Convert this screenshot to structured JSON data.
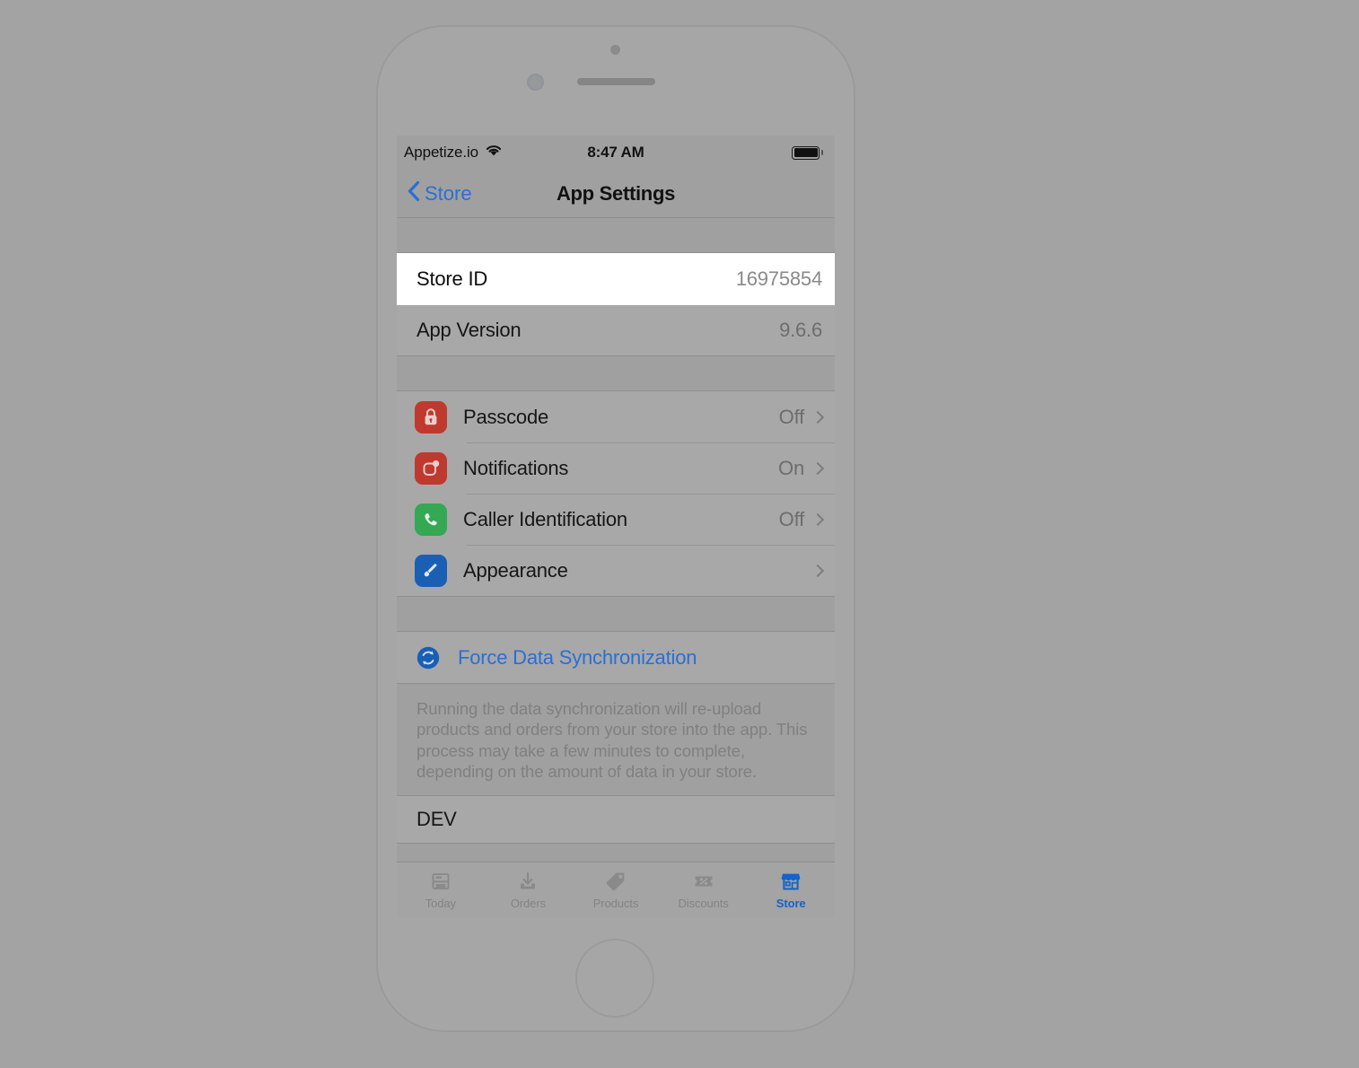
{
  "background_color": "#a3a3a3",
  "device": {
    "name": "iphone-frame",
    "frame_color": "#9a9a9a",
    "parts": [
      "sensor-dot",
      "front-camera",
      "earpiece-speaker",
      "home-button"
    ]
  },
  "status_bar": {
    "carrier": "Appetize.io",
    "wifi_icon": "wifi-icon",
    "time": "8:47 AM",
    "battery_icon": "battery-full-icon"
  },
  "nav_bar": {
    "back_icon": "chevron-left-icon",
    "back_label": "Store",
    "title": "App Settings"
  },
  "colors": {
    "accent_blue": "#2b6fd4",
    "tab_active_blue": "#1464c8",
    "icon_red": "#c0392f",
    "icon_green": "#34a853",
    "icon_blue": "#1a5fb4",
    "highlight_white": "#ffffff"
  },
  "info_group": {
    "rows": [
      {
        "label": "Store ID",
        "value": "16975854",
        "highlighted": true
      },
      {
        "label": "App Version",
        "value": "9.6.6",
        "highlighted": false
      }
    ]
  },
  "settings_group": {
    "rows": [
      {
        "icon": "lock-icon",
        "icon_color": "#c0392f",
        "label": "Passcode",
        "value": "Off",
        "chevron": true
      },
      {
        "icon": "notifications-icon",
        "icon_color": "#c0392f",
        "label": "Notifications",
        "value": "On",
        "chevron": true
      },
      {
        "icon": "phone-icon",
        "icon_color": "#34a853",
        "label": "Caller Identification",
        "value": "Off",
        "chevron": true
      },
      {
        "icon": "paintbrush-icon",
        "icon_color": "#1a5fb4",
        "label": "Appearance",
        "value": "",
        "chevron": true
      }
    ]
  },
  "sync_section": {
    "icon": "sync-circle-icon",
    "action_label": "Force Data Synchronization",
    "footer_text": "Running the data synchronization will re-upload products and orders from your store into the app. This process may take a few minutes to complete, depending on the amount of data in your store."
  },
  "dev_section": {
    "label": "DEV"
  },
  "tab_bar": {
    "items": [
      {
        "icon": "newspaper-icon",
        "label": "Today",
        "active": false
      },
      {
        "icon": "download-tray-icon",
        "label": "Orders",
        "active": false
      },
      {
        "icon": "tag-icon",
        "label": "Products",
        "active": false
      },
      {
        "icon": "ticket-percent-icon",
        "label": "Discounts",
        "active": false
      },
      {
        "icon": "storefront-icon",
        "label": "Store",
        "active": true
      }
    ]
  }
}
